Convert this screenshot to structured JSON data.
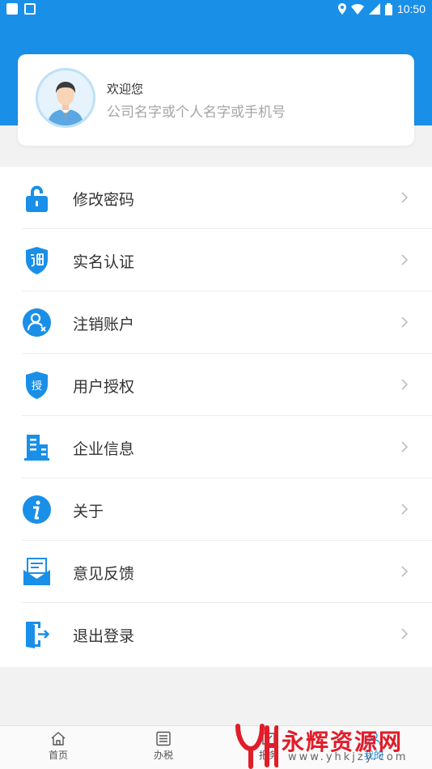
{
  "status_bar": {
    "time": "10:50"
  },
  "profile": {
    "welcome": "欢迎您",
    "subtitle": "公司名字或个人名字或手机号"
  },
  "menu": {
    "items": [
      {
        "label": "修改密码",
        "icon": "lock-icon"
      },
      {
        "label": "实名认证",
        "icon": "certificate-shield-icon"
      },
      {
        "label": "注销账户",
        "icon": "user-cancel-icon"
      },
      {
        "label": "用户授权",
        "icon": "authorize-shield-icon"
      },
      {
        "label": "企业信息",
        "icon": "building-icon"
      },
      {
        "label": "关于",
        "icon": "info-icon"
      },
      {
        "label": "意见反馈",
        "icon": "feedback-mail-icon"
      },
      {
        "label": "退出登录",
        "icon": "logout-door-icon"
      }
    ]
  },
  "bottom_nav": {
    "items": [
      {
        "label": "首页",
        "icon": "home-icon"
      },
      {
        "label": "办税",
        "icon": "list-icon"
      },
      {
        "label": "报务",
        "icon": "service-icon"
      },
      {
        "label": "我的",
        "icon": "user-icon"
      }
    ]
  },
  "watermark": {
    "text": "永辉资源网",
    "url": "www.yhkjzy.com",
    "logo_text": "YH"
  },
  "colors": {
    "primary": "#1a8fe8",
    "watermark": "#e21c29"
  }
}
